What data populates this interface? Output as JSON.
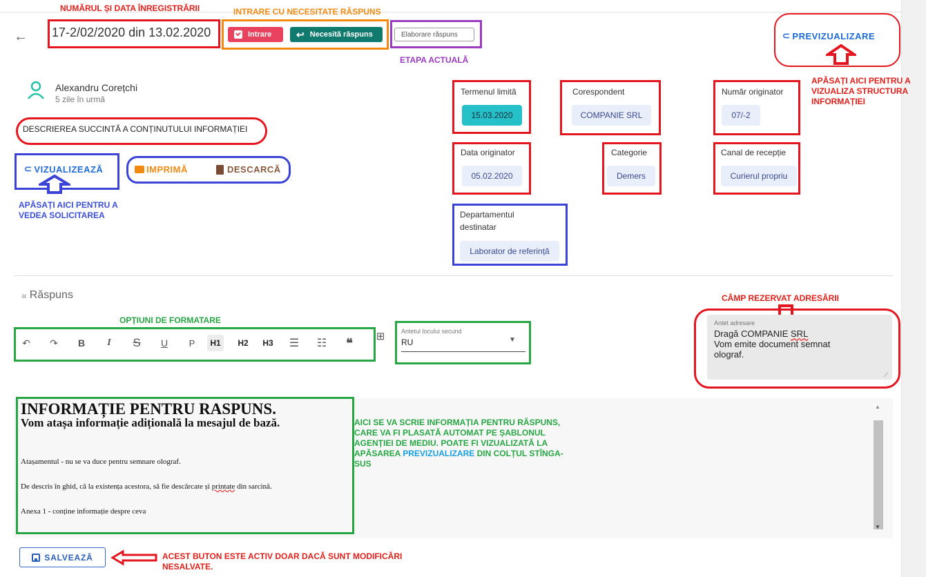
{
  "annotations": {
    "reg_number": "NUMĂRUL ȘI DATA ÎNREGISTRĂRII",
    "intrare": "INTRARE CU NECESITATE RĂSPUNS",
    "etapa": "ETAPA ACTUALĂ",
    "preview_line1": "APĂSAȚI AICI PENTRU A",
    "preview_line2": "VIZUALIZA STRUCTURA",
    "preview_line3": "INFORMAȚIEI",
    "view_line1": "APĂSAȚI AICI PENTRU A",
    "view_line2": "VEDEA SOLICITAREA",
    "formatting": "OPȚIUNI DE FORMATARE",
    "address": "CÂMP REZERVAT ADRESĂRII",
    "editor_line1": "AICI SE VA SCRIE INFORMAȚIA PENTRU RĂSPUNS,",
    "editor_line2": "CARE VA FI PLASATĂ AUTOMAT PE ȘABLONUL",
    "editor_line3": "AGENȚIEI DE MEDIU. POATE FI VIZUALIZATĂ LA",
    "editor_line4a": "APĂSAREA ",
    "editor_line4b": "PREVIZUALIZARE",
    "editor_line4c": " DIN COLȚUL STÎNGA-",
    "editor_line5": "SUS",
    "save_line1": "ACEST BUTON ESTE ACTIV DOAR DACĂ SUNT MODIFICĂRI",
    "save_line2": "NESALVATE."
  },
  "header": {
    "title": "17-2/02/2020 din 13.02.2020",
    "chip_intrare": "Intrare",
    "chip_raspuns": "Necesită răspuns",
    "chip_etapa": "Elaborare răspuns",
    "preview": "PREVIZUALIZARE"
  },
  "author": {
    "name": "Alexandru Corețchi",
    "time": "5 zile în urmă"
  },
  "description": "DESCRIEREA SUCCINTĂ A CONȚINUTULUI INFORMAȚIEI",
  "actions": {
    "view": "VIZUALIZEAZĂ",
    "print": "IMPRIMĂ",
    "download": "DESCARCĂ"
  },
  "fields": {
    "deadline_label": "Termenul limită",
    "deadline": "15.03.2020",
    "correspondent_label": "Corespondent",
    "correspondent": "COMPANIE SRL",
    "orig_num_label": "Număr originator",
    "orig_num": "07/-2",
    "orig_date_label": "Data originator",
    "orig_date": "05.02.2020",
    "category_label": "Categorie",
    "category": "Demers",
    "channel_label": "Canal de recepție",
    "channel": "Curierul propriu",
    "dept_label1": "Departamentul",
    "dept_label2": "destinatar",
    "dept": "Laborator de referință"
  },
  "reply": {
    "title": "Răspuns",
    "toolbar": [
      "P",
      "H1",
      "H2",
      "H3"
    ],
    "select_label": "Antetul locului secund",
    "select_value": "RU",
    "address_label": "Antet adresare",
    "address_line1": "Dragă COMPANIE ",
    "address_line1b": "SRL",
    "address_line2": "Vom emite document semnat",
    "address_line3": "olograf."
  },
  "doc": {
    "h1": "INFORMAȚIE PENTRU RASPUNS.",
    "h2": "Vom atașa informație adițională la mesajul de bază.",
    "p1": "Atașamentul - nu se va duce pentru semnare olograf.",
    "p2a": "De descris în ghid, că la existența acestora, să fie descărcate și ",
    "p2b": "printate",
    "p2c": " din sarcină.",
    "p3": "Anexa 1 - conține informație despre ceva"
  },
  "save": "SALVEAZĂ",
  "colors": {
    "teal": "#25c0c8",
    "chip_red": "#e8425e",
    "chip_teal": "#107a6f",
    "link": "#1e6bd6",
    "orange": "#f28a12"
  }
}
